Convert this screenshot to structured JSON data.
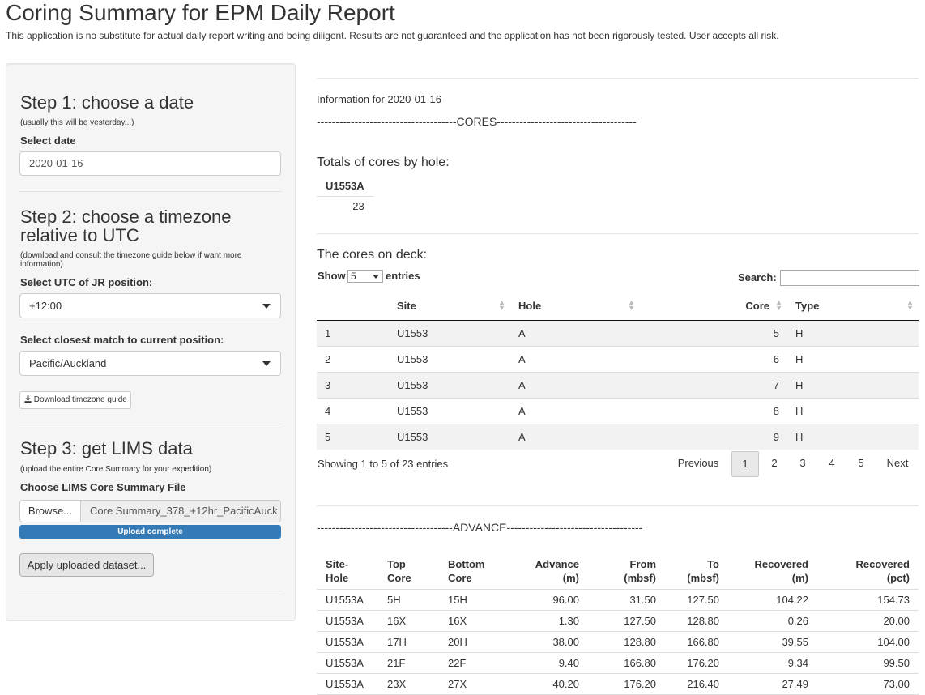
{
  "header": {
    "title": "Coring Summary for EPM Daily Report",
    "disclaimer": "This application is no substitute for actual daily report writing and being diligent. Results are not guaranteed and the application has not been rigorously tested. User accepts all risk."
  },
  "sidebar": {
    "step1": {
      "heading": "Step 1: choose a date",
      "note": "(usually this will be yesterday...)",
      "label": "Select date",
      "value": "2020-01-16"
    },
    "step2": {
      "heading_line1": "Step 2: choose a timezone",
      "heading_line2": "relative to UTC",
      "note_line1": "(download and consult the timezone guide below if want more",
      "note_line2": "information)",
      "utc_label": "Select UTC of JR position:",
      "utc_value": "+12:00",
      "match_label": "Select closest match to current position:",
      "match_value": "Pacific/Auckland",
      "download_label": "Download timezone guide"
    },
    "step3": {
      "heading": "Step 3: get LIMS data",
      "note": "(upload the entire Core Summary for your expedition)",
      "file_label": "Choose LIMS Core Summary File",
      "browse_label": "Browse...",
      "file_name": "Core Summary_378_+12hr_PacificAuck",
      "progress_label": "Upload complete",
      "progress_fraction": 1.0,
      "apply_label": "Apply uploaded dataset..."
    }
  },
  "main": {
    "info_line": "Information for 2020-01-16",
    "cores_divider": "-------------------------------------CORES-------------------------------------",
    "totals_title": "Totals of cores by hole:",
    "totals": {
      "header": "U1553A",
      "value": "23"
    },
    "cores_title": "The cores on deck:",
    "show_label": "Show",
    "show_value": "5",
    "entries_label": "entries",
    "search_label": "Search:",
    "cores_table": {
      "columns": [
        "",
        "Site",
        "Hole",
        "Core",
        "Type"
      ],
      "rows": [
        [
          "1",
          "U1553",
          "A",
          "5",
          "H"
        ],
        [
          "2",
          "U1553",
          "A",
          "6",
          "H"
        ],
        [
          "3",
          "U1553",
          "A",
          "7",
          "H"
        ],
        [
          "4",
          "U1553",
          "A",
          "8",
          "H"
        ],
        [
          "5",
          "U1553",
          "A",
          "9",
          "H"
        ]
      ]
    },
    "pagination": {
      "info": "Showing 1 to 5 of 23 entries",
      "previous": "Previous",
      "pages": [
        "1",
        "2",
        "3",
        "4",
        "5"
      ],
      "next": "Next"
    },
    "advance_divider": "------------------------------------ADVANCE------------------------------------",
    "advance_table": {
      "columns": [
        [
          "Site-",
          "Hole"
        ],
        [
          "Top",
          "Core"
        ],
        [
          "Bottom",
          "Core"
        ],
        [
          "Advance",
          "(m)"
        ],
        [
          "From",
          "(mbsf)"
        ],
        [
          "To",
          "(mbsf)"
        ],
        [
          "Recovered",
          "(m)"
        ],
        [
          "Recovered",
          "(pct)"
        ]
      ],
      "rows": [
        [
          "U1553A",
          "5H",
          "15H",
          "96.00",
          "31.50",
          "127.50",
          "104.22",
          "154.73"
        ],
        [
          "U1553A",
          "16X",
          "16X",
          "1.30",
          "127.50",
          "128.80",
          "0.26",
          "20.00"
        ],
        [
          "U1553A",
          "17H",
          "20H",
          "38.00",
          "128.80",
          "166.80",
          "39.55",
          "104.00"
        ],
        [
          "U1553A",
          "21F",
          "22F",
          "9.40",
          "166.80",
          "176.20",
          "9.34",
          "99.50"
        ],
        [
          "U1553A",
          "23X",
          "27X",
          "40.20",
          "176.20",
          "216.40",
          "27.49",
          "73.00"
        ]
      ]
    }
  }
}
